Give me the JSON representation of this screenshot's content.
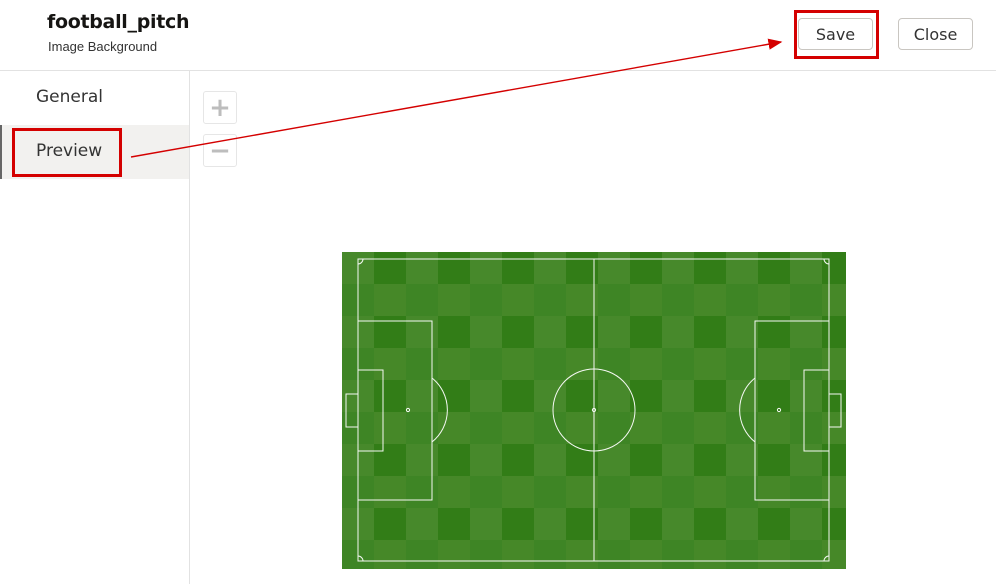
{
  "header": {
    "title": "football_pitch",
    "subtitle": "Image Background",
    "save_label": "Save",
    "close_label": "Close"
  },
  "sidebar": {
    "items": [
      {
        "label": "General"
      },
      {
        "label": "Preview"
      }
    ]
  },
  "zoom": {
    "in_label": "+",
    "out_label": "−"
  },
  "colors": {
    "pitch_dark": "#2f7d14",
    "pitch_light": "#4f8a2e",
    "annotation_red": "#d40000"
  }
}
